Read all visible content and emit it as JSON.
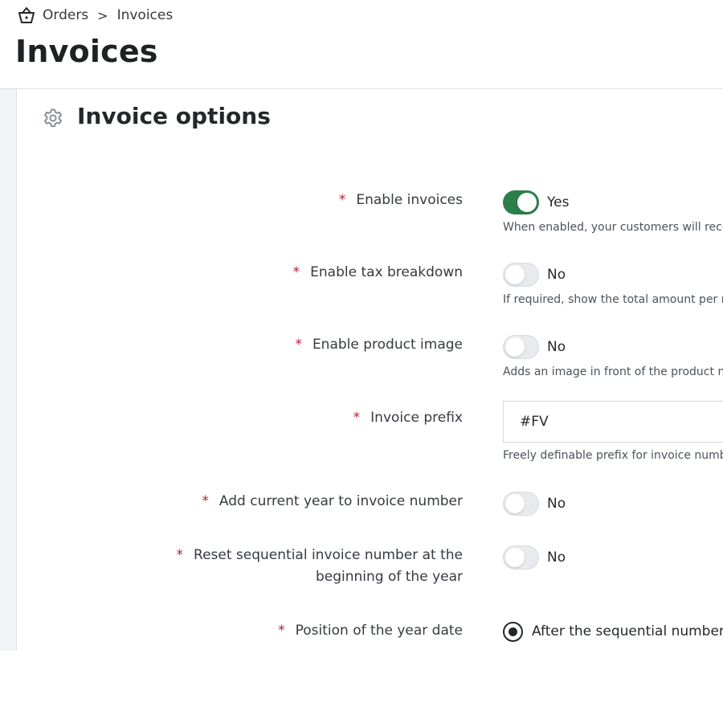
{
  "breadcrumb": {
    "root": "Orders",
    "separator": ">",
    "current": "Invoices",
    "root_icon": "basket-icon"
  },
  "page": {
    "title": "Invoices"
  },
  "section": {
    "title": "Invoice options",
    "icon": "gear-icon"
  },
  "required_marker": "*",
  "fields": {
    "enable_invoices": {
      "label": "Enable invoices",
      "state": "Yes",
      "on": true,
      "help": "When enabled, your customers will receive"
    },
    "enable_tax_breakdown": {
      "label": "Enable tax breakdown",
      "state": "No",
      "on": false,
      "help": "If required, show the total amount per rate"
    },
    "enable_product_image": {
      "label": "Enable product image",
      "state": "No",
      "on": false,
      "help": "Adds an image in front of the product name"
    },
    "invoice_prefix": {
      "label": "Invoice prefix",
      "value": "#FV",
      "help": "Freely definable prefix for invoice numbers"
    },
    "add_current_year": {
      "label": "Add current year to invoice number",
      "state": "No",
      "on": false
    },
    "reset_sequential": {
      "label_line1": "Reset sequential invoice number at the",
      "label_line2": "beginning of the year",
      "state": "No",
      "on": false
    },
    "year_position": {
      "label": "Position of the year date",
      "option": "After the sequential number",
      "selected": true
    }
  },
  "colors": {
    "toggle_on": "#2a7f4a",
    "required": "#b32033",
    "text": "#25282b"
  }
}
